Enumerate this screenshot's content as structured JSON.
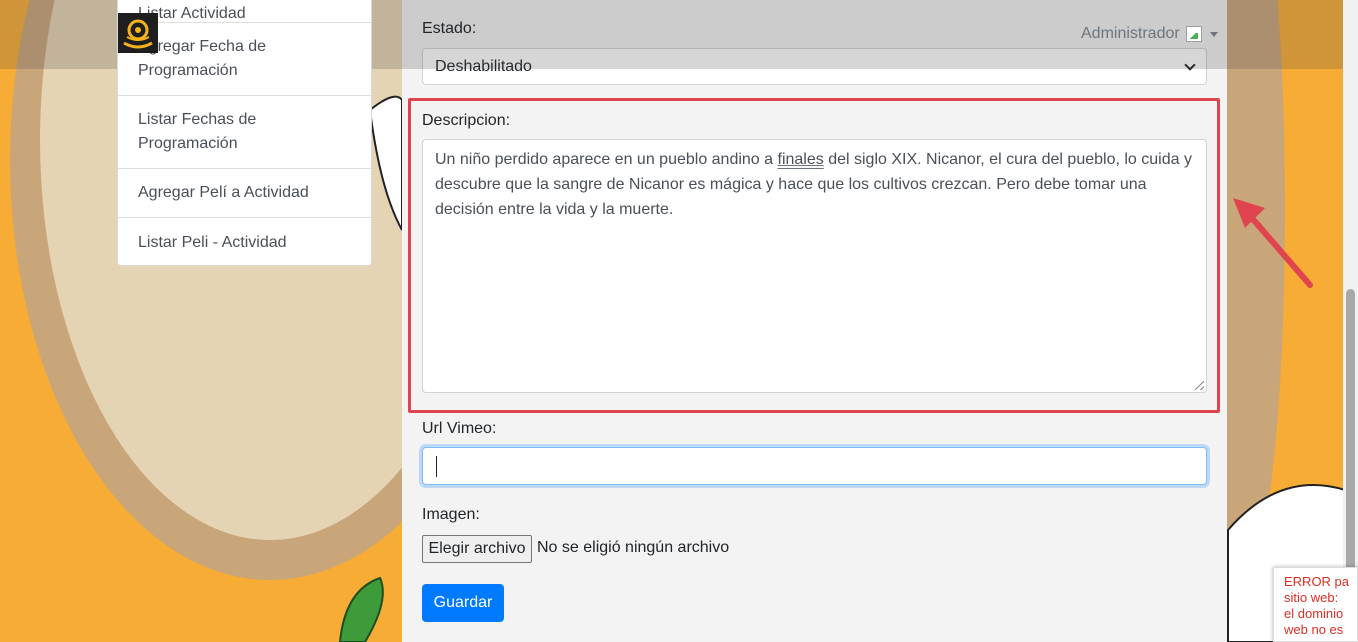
{
  "header": {
    "user_label": "Administrador",
    "logo_icon": "sun-spiral-logo"
  },
  "menu": {
    "items": [
      {
        "label": "Listar Actividad"
      },
      {
        "label": "Agregar Fecha de Programación"
      },
      {
        "label": "Listar Fechas de Programación"
      },
      {
        "label": "Agregar Pelí a Actividad"
      },
      {
        "label": "Listar Peli - Actividad"
      }
    ]
  },
  "form": {
    "estado_label": "Estado:",
    "estado_value": "Deshabilitado",
    "descripcion_label": "Descripcion:",
    "descripcion_before": "Un niño perdido aparece en un pueblo andino a ",
    "descripcion_underlined": "finales",
    "descripcion_after": " del siglo XIX. Nicanor, el cura del pueblo, lo cuida y descubre que la sangre de Nicanor es mágica y hace que los cultivos crezcan. Pero debe tomar una decisión entre la vida y la muerte.",
    "url_label": "Url Vimeo:",
    "url_value": "",
    "imagen_label": "Imagen:",
    "file_button": "Elegir archivo",
    "file_status": "No se eligió ningún archivo",
    "save_button": "Guardar"
  },
  "captcha_error": {
    "line1": "ERROR pa",
    "line2": "sitio web:",
    "line3": "el dominio",
    "line4": "web no es"
  },
  "colors": {
    "background": "#f6ac35",
    "primary_button": "#007bff",
    "highlight": "#e0454f"
  }
}
